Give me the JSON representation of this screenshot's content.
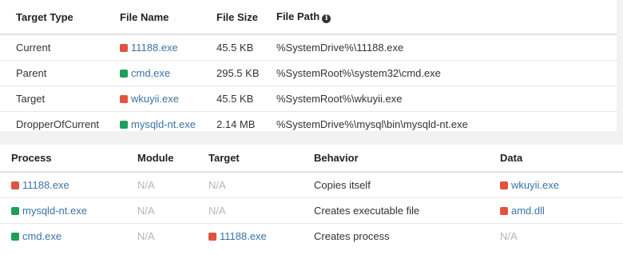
{
  "files": {
    "headers": [
      "Target Type",
      "File Name",
      "File Size",
      "File Path"
    ],
    "rows": [
      {
        "type": "Current",
        "name": "11188.exe",
        "status": "red",
        "size": "45.5 KB",
        "path": "%SystemDrive%\\11188.exe"
      },
      {
        "type": "Parent",
        "name": "cmd.exe",
        "status": "green",
        "size": "295.5 KB",
        "path": "%SystemRoot%\\system32\\cmd.exe"
      },
      {
        "type": "Target",
        "name": "wkuyii.exe",
        "status": "red",
        "size": "45.5 KB",
        "path": "%SystemRoot%\\wkuyii.exe"
      },
      {
        "type": "DropperOfCurrent",
        "name": "mysqld-nt.exe",
        "status": "green",
        "size": "2.14 MB",
        "path": "%SystemDrive%\\mysql\\bin\\mysqld-nt.exe"
      }
    ]
  },
  "behaviors": {
    "headers": [
      "Process",
      "Module",
      "Target",
      "Behavior",
      "Data"
    ],
    "rows": [
      {
        "process": "11188.exe",
        "process_status": "red",
        "module": "N/A",
        "target": "N/A",
        "target_status": null,
        "behavior": "Copies itself",
        "data": "wkuyii.exe",
        "data_status": "red"
      },
      {
        "process": "mysqld-nt.exe",
        "process_status": "green",
        "module": "N/A",
        "target": "N/A",
        "target_status": null,
        "behavior": "Creates executable file",
        "data": "amd.dll",
        "data_status": "red"
      },
      {
        "process": "cmd.exe",
        "process_status": "green",
        "module": "N/A",
        "target": "11188.exe",
        "target_status": "red",
        "behavior": "Creates process",
        "data": "N/A",
        "data_status": null
      }
    ]
  },
  "icons": {
    "file_path_info": "info-icon",
    "status_square": "status-square-icon"
  },
  "colors": {
    "red": "#e0533f",
    "green": "#1e9e5a",
    "link": "#3a73a6",
    "na": "#b5b5b5"
  }
}
